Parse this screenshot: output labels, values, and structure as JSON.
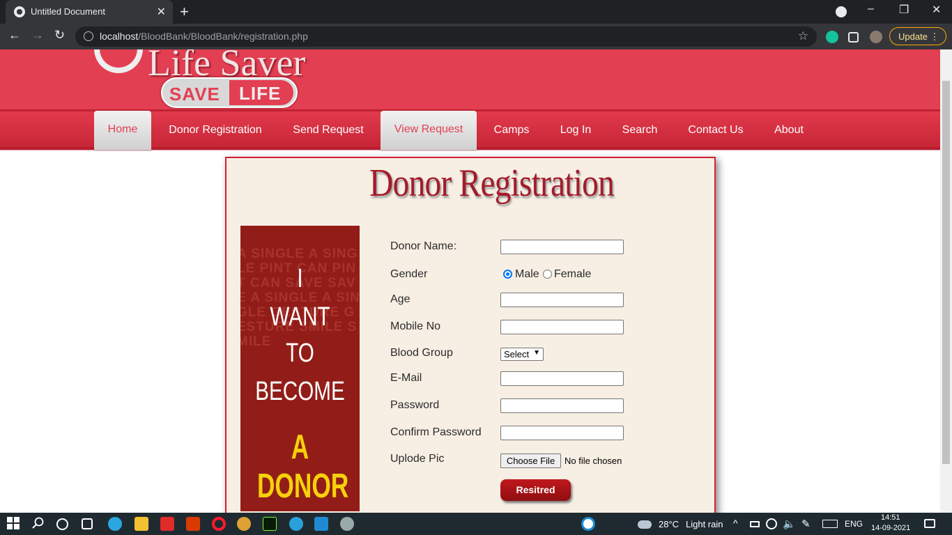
{
  "browser": {
    "tab_title": "Untitled Document",
    "close_glyph": "✕",
    "new_tab_glyph": "+",
    "url_host": "localhost",
    "url_path": "/BloodBank/BloodBank/registration.php",
    "update_label": "Update ⋮",
    "back_glyph": "←",
    "forward_glyph": "→",
    "reload_glyph": "↻",
    "star_glyph": "☆",
    "minimize_glyph": "–",
    "restore_glyph": "❐",
    "window_close_glyph": "✕"
  },
  "site": {
    "logo_text": "Life Saver",
    "logo_save": "SAVE",
    "logo_life": "LIFE",
    "nav": [
      {
        "label": "Home",
        "active": true
      },
      {
        "label": "Donor Registration",
        "active": false
      },
      {
        "label": "Send Request",
        "active": false
      },
      {
        "label": "View Request",
        "active": true
      },
      {
        "label": "Camps",
        "active": false
      },
      {
        "label": "Log In",
        "active": false
      },
      {
        "label": "Search",
        "active": false
      },
      {
        "label": "Contact Us",
        "active": false
      },
      {
        "label": "About",
        "active": false
      }
    ]
  },
  "form": {
    "title": "Donor Registration",
    "poster": {
      "line1": "I",
      "line2": "WANT",
      "line3": "TO",
      "line4": "BECOME",
      "line5": "A DONOR",
      "background_text": "A SINGLE A SINGLE PINT CAN PINT CAN SAVE SAVE A SINGLE A SINGLE GESTURE GESTURE SMILE SMILE"
    },
    "labels": {
      "name": "Donor Name:",
      "gender": "Gender",
      "age": "Age",
      "mobile": "Mobile No",
      "blood_group": "Blood Group",
      "email": "E-Mail",
      "password": "Password",
      "confirm_password": "Confirm Password",
      "upload": "Uplode Pic"
    },
    "gender_options": {
      "male": "Male",
      "female": "Female",
      "selected": "Male"
    },
    "blood_group_value": "Select",
    "file_button": "Choose File",
    "file_status": "No file chosen",
    "submit_label": "Resitred"
  },
  "taskbar": {
    "temperature": "28°C",
    "weather": "Light rain",
    "language": "ENG",
    "time": "14:51",
    "date": "14-09-2021"
  },
  "colors": {
    "header_red": "#e33f52",
    "title_red": "#a41b2a",
    "panel_bg": "#f7efe4",
    "poster_red": "#921d18",
    "donor_yellow": "#f6d10b"
  }
}
